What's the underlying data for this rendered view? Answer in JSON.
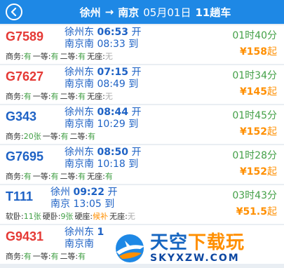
{
  "header": {
    "from": "徐州",
    "arrow": "→",
    "to": "南京",
    "date": "05月01日",
    "count": "11趟车"
  },
  "colors": {
    "header_bg": "#1e88e5",
    "train_red": "#e53935",
    "train_blue": "#1e62c5",
    "duration_green": "#43a047",
    "price_orange": "#ff8f00"
  },
  "trains": [
    {
      "no": "G7589",
      "no_color": "red",
      "dep_station": "徐州东",
      "dep_time": "06:53",
      "dep_tag": "开",
      "arr_station": "南京南",
      "arr_time": "08:33",
      "arr_tag": "到",
      "duration": "01时40分",
      "price": "¥158",
      "price_suffix": "起",
      "seats": [
        {
          "label": "商务:",
          "count": "有",
          "state": "green"
        },
        {
          "label": "一等:",
          "count": "有",
          "state": "green"
        },
        {
          "label": "二等:",
          "count": "有",
          "state": "green"
        },
        {
          "label": "无座:",
          "count": "无",
          "state": "gray"
        }
      ]
    },
    {
      "no": "G7627",
      "no_color": "red",
      "dep_station": "徐州东",
      "dep_time": "07:15",
      "dep_tag": "开",
      "arr_station": "南京南",
      "arr_time": "08:49",
      "arr_tag": "到",
      "duration": "01时34分",
      "price": "¥145",
      "price_suffix": "起",
      "seats": [
        {
          "label": "商务:",
          "count": "有",
          "state": "green"
        },
        {
          "label": "一等:",
          "count": "有",
          "state": "green"
        },
        {
          "label": "二等:",
          "count": "有",
          "state": "green"
        },
        {
          "label": "无座:",
          "count": "无",
          "state": "gray"
        }
      ]
    },
    {
      "no": "G343",
      "no_color": "blue",
      "dep_station": "徐州东",
      "dep_time": "08:44",
      "dep_tag": "开",
      "arr_station": "南京南",
      "arr_time": "10:29",
      "arr_tag": "到",
      "duration": "01时45分",
      "price": "¥152",
      "price_suffix": "起",
      "seats": [
        {
          "label": "商务:",
          "count": "20张",
          "state": "green"
        },
        {
          "label": "一等:",
          "count": "有",
          "state": "green"
        },
        {
          "label": "二等:",
          "count": "有",
          "state": "green"
        }
      ]
    },
    {
      "no": "G7695",
      "no_color": "blue",
      "dep_station": "徐州东",
      "dep_time": "08:50",
      "dep_tag": "开",
      "arr_station": "南京南",
      "arr_time": "10:18",
      "arr_tag": "到",
      "duration": "01时28分",
      "price": "¥152",
      "price_suffix": "起",
      "seats": [
        {
          "label": "商务:",
          "count": "有",
          "state": "green"
        },
        {
          "label": "一等:",
          "count": "有",
          "state": "green"
        },
        {
          "label": "二等:",
          "count": "有",
          "state": "green"
        },
        {
          "label": "无座:",
          "count": "有",
          "state": "green"
        }
      ]
    },
    {
      "no": "T111",
      "no_color": "blue",
      "dep_station": "徐州",
      "dep_time": "09:22",
      "dep_tag": "开",
      "arr_station": "南京",
      "arr_time": "13:05",
      "arr_tag": "到",
      "duration": "03时43分",
      "price": "¥51.5",
      "price_suffix": "起",
      "seats": [
        {
          "label": "软卧:",
          "count": "11张",
          "state": "green"
        },
        {
          "label": "硬卧:",
          "count": "9张",
          "state": "green"
        },
        {
          "label": "硬座:",
          "count": "候补",
          "state": "orange"
        },
        {
          "label": "无座:",
          "count": "无",
          "state": "gray"
        }
      ]
    },
    {
      "no": "G9431",
      "no_color": "red",
      "dep_station": "徐州东",
      "dep_time": "1",
      "dep_tag": "",
      "arr_station": "南京南",
      "arr_time": "",
      "arr_tag": "",
      "duration": "",
      "price": "",
      "price_suffix": "",
      "seats": [
        {
          "label": "商务:",
          "count": "有",
          "state": "green"
        },
        {
          "label": "一等:",
          "count": "有",
          "state": "green"
        },
        {
          "label": "二等:",
          "count": "有",
          "state": "green"
        }
      ]
    }
  ],
  "watermark": {
    "cn_part1": "天空",
    "cn_part2": "下载玩",
    "en": "SKYXZW.COM"
  }
}
